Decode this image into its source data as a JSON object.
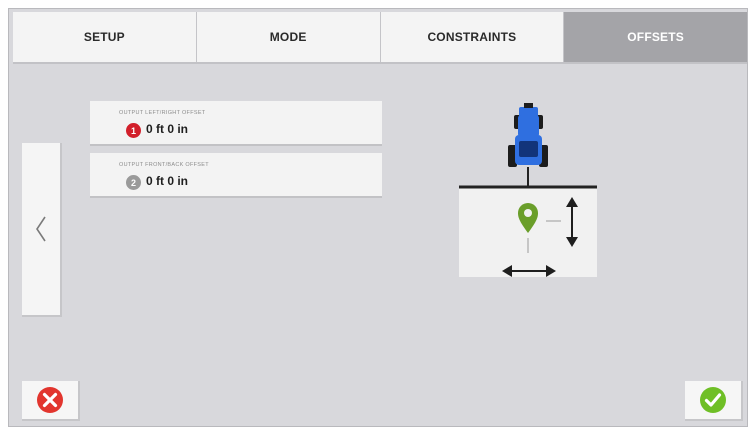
{
  "tabs": [
    {
      "label": "SETUP",
      "active": false
    },
    {
      "label": "MODE",
      "active": false
    },
    {
      "label": "CONSTRAINTS",
      "active": false
    },
    {
      "label": "OFFSETS",
      "active": true
    }
  ],
  "back_button": {
    "icon": "chevron-left-icon"
  },
  "fields": [
    {
      "label": "OUTPUT LEFT/RIGHT OFFSET",
      "badge": "1",
      "badge_color": "#d21f2a",
      "value": "0 ft 0 in"
    },
    {
      "label": "OUTPUT FRONT/BACK OFFSET",
      "badge": "2",
      "badge_color": "#9a9a9a",
      "value": "0 ft 0 in"
    }
  ],
  "diagram": {
    "vehicle_icon": "tractor-icon",
    "vehicle_color": "#2f6fe0",
    "marker_icon": "location-pin-icon",
    "marker_color": "#6a9e2a",
    "vertical_arrow_icon": "double-arrow-vertical-icon",
    "horizontal_arrow_icon": "double-arrow-horizontal-icon"
  },
  "actions": {
    "cancel_icon": "cancel-x-icon",
    "cancel_color": "#e2352e",
    "confirm_icon": "confirm-check-icon",
    "confirm_color": "#6fbf26"
  }
}
